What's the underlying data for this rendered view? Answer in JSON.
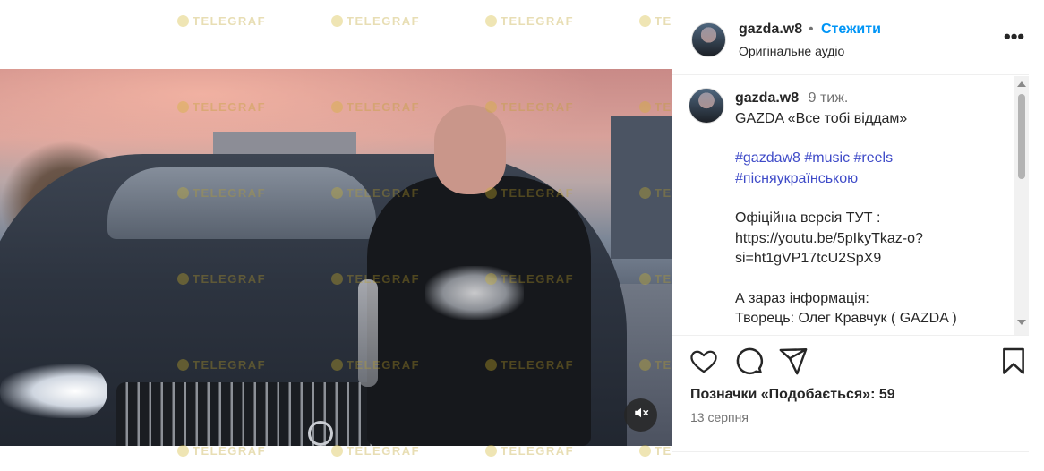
{
  "watermark": {
    "text": "TELEGRAF"
  },
  "header": {
    "username": "gazda.w8",
    "separator": "•",
    "follow_label": "Стежити",
    "audio_label": "Оригінальне аудіо",
    "more_label": "•••"
  },
  "caption": {
    "username": "gazda.w8",
    "time": "9 тиж.",
    "title": "GAZDA «Все тобі віддам»",
    "hashtags_line1": "#gazdaw8 #music #reels",
    "hashtags_line2": "#пісняукраїнською",
    "official_label": "Офіційна версія ТУТ :",
    "link_line1": "https://youtu.be/5pIkyTkaz-o?",
    "link_line2": "si=ht1gVP17tcU2SpX9",
    "info_label": "А зараз інформація:",
    "creator_line": "Творець: Олег Кравчук ( GAZDA )"
  },
  "stats": {
    "likes_text": "Позначки «Подобається»: 59",
    "date_text": "13 серпня"
  },
  "icons": {
    "like": "heart-icon",
    "comment": "comment-icon",
    "share": "share-icon",
    "save": "bookmark-icon",
    "mute": "speaker-muted-icon",
    "more": "more-icon"
  },
  "colors": {
    "follow": "#0095f6",
    "hashtag": "#3f4bc8",
    "muted_text": "#737373"
  }
}
